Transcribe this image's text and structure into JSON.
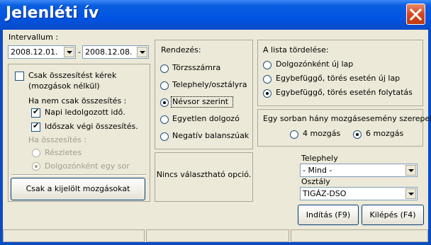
{
  "window": {
    "title": "Jelenléti ív",
    "close_icon": "close-x-icon"
  },
  "interval": {
    "label": "Intervallum :",
    "from": "2008.12.01.",
    "separator": "-",
    "to": "2008.12.08."
  },
  "summary": {
    "only_summary": "Csak összesítést kérek",
    "only_summary_sub": "(mozgások nélkül)",
    "if_not_only": "Ha nem csak összesítés :",
    "daily_overtime": "Napi ledolgozott idő.",
    "period_end": "Időszak végi összesítés.",
    "if_summary": "Ha összesítés :",
    "detailed": "Részletes",
    "per_employee": "Dolgozónként egy sor",
    "selected_button": "Csak a kijelölt mozgásokat"
  },
  "sort": {
    "label": "Rendezés:",
    "options": [
      "Törzsszámra",
      "Telephely/osztályra",
      "Névsor szerint",
      "Egyetlen dolgozó",
      "Negatív balanszúak"
    ],
    "selected_index": 2
  },
  "pagebreak": {
    "label": "A lista tördelése:",
    "options": [
      "Dolgozónként új lap",
      "Egybefüggő, törés esetén új lap",
      "Egybefüggő, törés esetén folytatás"
    ],
    "selected_index": 2
  },
  "movements": {
    "question": "Egy sorban hány mozgásesemény szerepeljen?",
    "options": [
      "4 mozgás",
      "6 mozgás"
    ],
    "selected_index": 1
  },
  "no_option_text": "Nincs választható opció.",
  "site": {
    "label": "Telephely",
    "value": "- Mind -"
  },
  "department": {
    "label": "Osztály",
    "value": "TIGÁZ-DSO"
  },
  "buttons": {
    "start": "Indítás (F9)",
    "exit": "Kilépés (F4)"
  }
}
